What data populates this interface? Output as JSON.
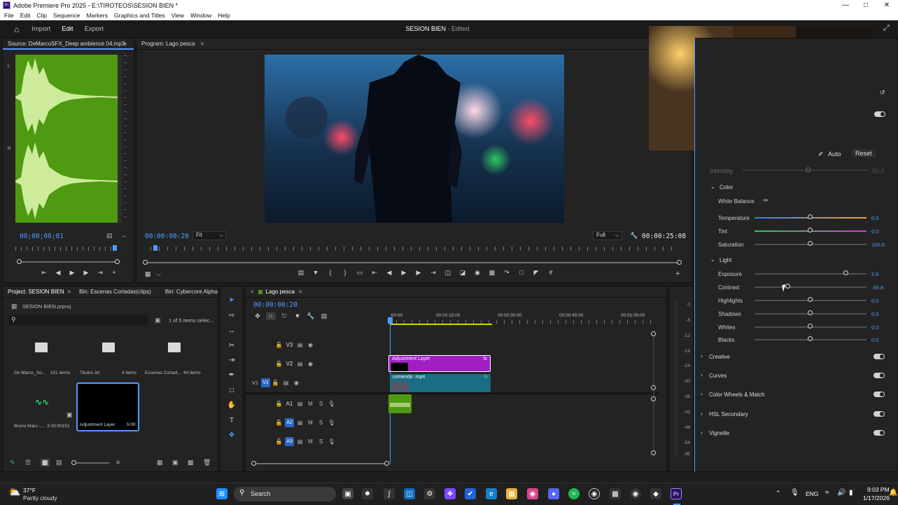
{
  "window": {
    "title": "Adobe Premiere Pro 2025 - E:\\TIROTEOS\\SESION BIEN *",
    "app_icon": "Pr"
  },
  "menu": [
    "File",
    "Edit",
    "Clip",
    "Sequence",
    "Markers",
    "Graphics and Titles",
    "View",
    "Window",
    "Help"
  ],
  "workspace": {
    "tabs": [
      "Import",
      "Edit",
      "Export"
    ],
    "active": "Edit",
    "sequence_name": "SESION BIEN",
    "status": " - Edited"
  },
  "source": {
    "title": "Source: DeMarcoSFX_Deep ambience 04.mp3",
    "timecode": "00;00;06;01",
    "channel_labels": [
      "L",
      "L",
      "R",
      "R"
    ]
  },
  "program": {
    "title": "Program: Lago pesca",
    "timecode": "00:00:00:20",
    "fit": "Fit",
    "quality": "Full",
    "duration": "00:00:25:08"
  },
  "project": {
    "tabs": [
      "Project: SESION BIEN",
      "Bin: Escenas Cortadas(clips)",
      "Bin: Cybercore Alphabi"
    ],
    "file": "SESION BIEN.prproj",
    "selection_info": "1 of 5 items selec...",
    "items": [
      {
        "name": "De Marco_So...",
        "meta": "101 items",
        "icon": "folder-icon"
      },
      {
        "name": "Titulos 3d",
        "meta": "4 items",
        "icon": "folder-icon"
      },
      {
        "name": "Escenas Cortad...",
        "meta": "44 items",
        "icon": "folder-icon"
      },
      {
        "name": "Bruno Mars -...",
        "meta": "3:33:00151",
        "icon": "audio-wave-icon"
      },
      {
        "name": "Adjustment Layer",
        "meta": "5:00",
        "icon": "video-thumb"
      }
    ]
  },
  "timeline": {
    "tab": "Lago pesca",
    "timecode": "00:00:00:20",
    "ruler": [
      ":00:00",
      "00:00:15:00",
      "00:00:30:00",
      "00:00:45:00",
      "00:01:00:00"
    ],
    "tracks": [
      {
        "id": "V3",
        "toggles": [
          "lock-icon",
          "film-icon",
          "eye-icon"
        ]
      },
      {
        "id": "V2",
        "toggles": [
          "lock-icon",
          "film-icon",
          "eye-icon"
        ]
      },
      {
        "id": "V1",
        "target": "V1",
        "toggles": [
          "lock-icon",
          "film-icon",
          "eye-icon"
        ]
      },
      {
        "id": "A1",
        "toggles": [
          "lock-icon",
          "film-icon",
          "M",
          "S",
          "mic-icon"
        ]
      },
      {
        "id": "A2",
        "toggles": [
          "lock-icon",
          "film-icon",
          "M",
          "S",
          "mic-icon"
        ]
      },
      {
        "id": "A3",
        "toggles": [
          "lock-icon",
          "film-icon",
          "M",
          "S",
          "mic-icon"
        ]
      }
    ],
    "clips": [
      {
        "name": "Adjustment Layer",
        "fx": "fx"
      },
      {
        "name": "comendo .mp4",
        "fx": "fx"
      }
    ],
    "meter_db": [
      "0",
      "-6",
      "-12",
      "-18",
      "-24",
      "-30",
      "-36",
      "-42",
      "-48",
      "-54",
      "dB"
    ]
  },
  "lumetri": {
    "auto": "Auto",
    "reset": "Reset",
    "intensity": {
      "label": "Intensity",
      "value": "50.0"
    },
    "color_section": "Color",
    "white_balance": "White Balance",
    "color_rows": [
      {
        "label": "Temperature",
        "value": "0.0",
        "pos": 0.5
      },
      {
        "label": "Tint",
        "value": "0.0",
        "pos": 0.5
      },
      {
        "label": "Saturation",
        "value": "100.0",
        "pos": 0.5
      }
    ],
    "light_section": "Light",
    "light_rows": [
      {
        "label": "Exposure",
        "value": "2.6",
        "pos": 0.82
      },
      {
        "label": "Contrast",
        "value": "-39.8",
        "pos": 0.3
      },
      {
        "label": "Highlights",
        "value": "0.0",
        "pos": 0.5
      },
      {
        "label": "Shadows",
        "value": "0.0",
        "pos": 0.5
      },
      {
        "label": "Whites",
        "value": "0.0",
        "pos": 0.5
      },
      {
        "label": "Blacks",
        "value": "0.0",
        "pos": 0.5
      }
    ],
    "collapsed_sections": [
      "Creative",
      "Curves",
      "Color Wheels & Match",
      "HSL Secondary",
      "Vignette"
    ]
  },
  "taskbar": {
    "weather_temp": "37°F",
    "weather_desc": "Partly cloudy",
    "search_placeholder": "Search",
    "lang": "ENG",
    "time": "9:03 PM",
    "date": "1/17/2026"
  },
  "colors": {
    "accent": "#4f9cff",
    "adjustment_clip": "#a01fc2",
    "video_clip": "#1a6d84",
    "audio_wave": "#4e9a12"
  }
}
